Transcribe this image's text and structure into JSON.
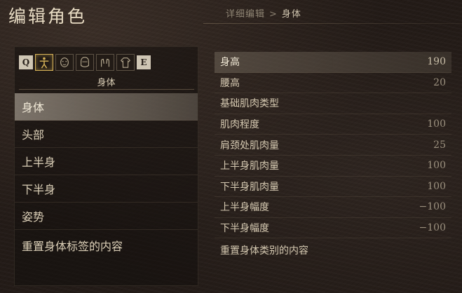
{
  "header": {
    "title": "编辑角色",
    "breadcrumb": {
      "parent": "详细编辑",
      "separator": ">",
      "current": "身体"
    }
  },
  "tabs": {
    "key_left": "Q",
    "key_right": "E",
    "icons": [
      "body-icon",
      "face-icon",
      "head-icon",
      "hands-icon",
      "torso-icon"
    ],
    "active_label": "身体"
  },
  "menu": {
    "items": [
      {
        "label": "身体",
        "selected": true
      },
      {
        "label": "头部"
      },
      {
        "label": "上半身"
      },
      {
        "label": "下半身"
      },
      {
        "label": "姿势"
      },
      {
        "label": "重置身体标签的内容"
      }
    ]
  },
  "properties": {
    "rows": [
      {
        "label": "身高",
        "value": "190",
        "selected": true
      },
      {
        "label": "腰高",
        "value": "20"
      },
      {
        "label": "基础肌肉类型",
        "value": ""
      },
      {
        "label": "肌肉程度",
        "value": "100"
      },
      {
        "label": "肩颈处肌肉量",
        "value": "25"
      },
      {
        "label": "上半身肌肉量",
        "value": "100"
      },
      {
        "label": "下半身肌肉量",
        "value": "100"
      },
      {
        "label": "上半身幅度",
        "value": "−100"
      },
      {
        "label": "下半身幅度",
        "value": "−100"
      },
      {
        "label": "重置身体类别的内容",
        "value": ""
      }
    ]
  },
  "colors": {
    "accent": "#d8b458",
    "background": "#231b17",
    "text": "#d8ccb4"
  }
}
